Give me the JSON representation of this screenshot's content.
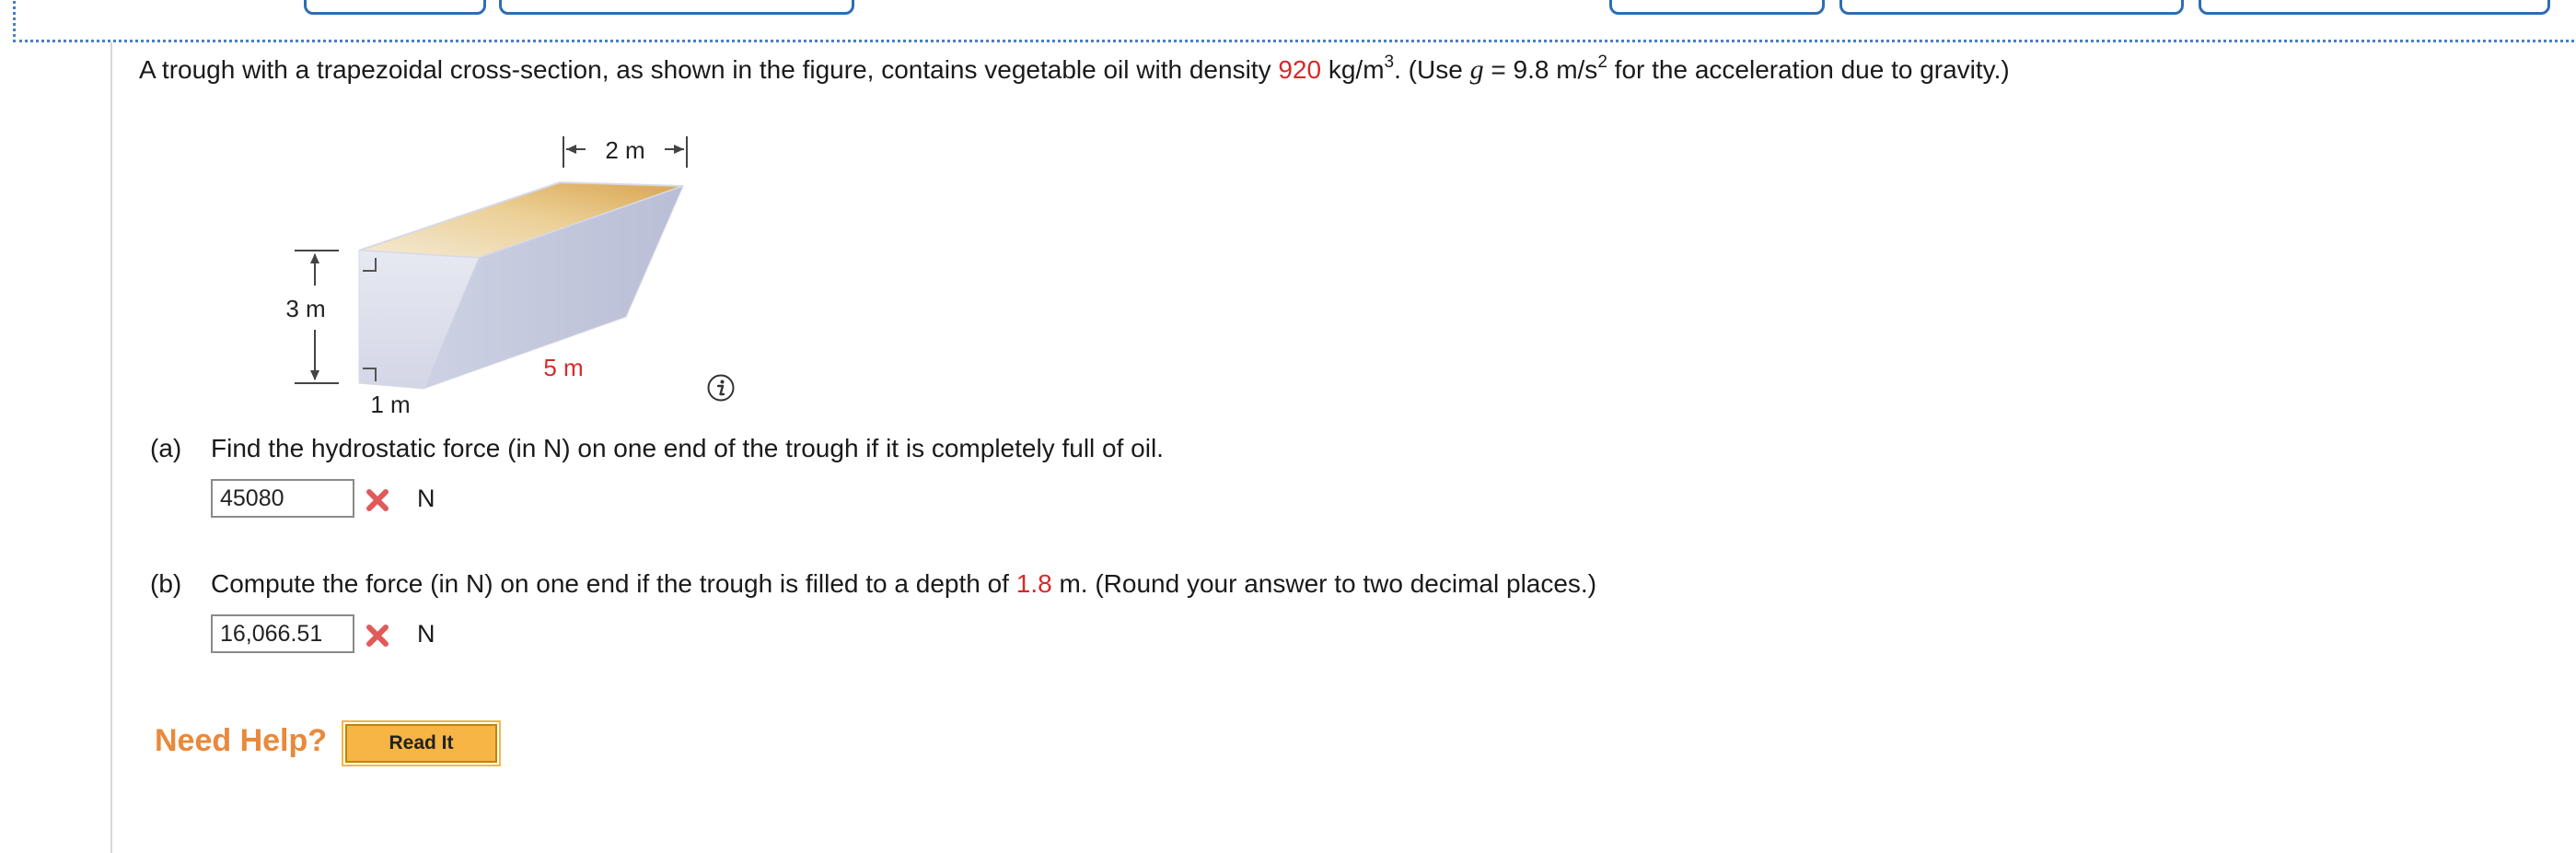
{
  "question": {
    "intro": "A trough with a trapezoidal cross-section, as shown in the figure, contains vegetable oil with density ",
    "density_value": "920",
    "density_unit": " kg/m",
    "density_exp": "3",
    "use_text": ". (Use ",
    "g_symbol": "g",
    "g_equals": " = 9.8 m/s",
    "g_exp": "2",
    "tail": " for the acceleration due to gravity.)"
  },
  "figure": {
    "top_width": "2 m",
    "height": "3 m",
    "length": "5 m",
    "bottom_width": "1 m",
    "colors": {
      "oil_dark": "#d9a85a",
      "oil_light": "#f3e3bf",
      "trough_side": "#c9cde0",
      "trough_end": "#dfe2ee"
    }
  },
  "part_a": {
    "label": "(a)",
    "text": "Find the hydrostatic force (in N) on one end of the trough if it is completely full of oil.",
    "answer": "45080",
    "unit": "N",
    "status": "incorrect"
  },
  "part_b": {
    "label": "(b)",
    "text_before": "Compute the force (in N) on one end if the trough is filled to a depth of ",
    "depth_value": "1.8",
    "text_after": " m. (Round your answer to two decimal places.)",
    "answer": "16,066.51",
    "unit": "N",
    "status": "incorrect"
  },
  "help": {
    "label": "Need Help?",
    "read_it": "Read It"
  },
  "icons": [
    "info-icon",
    "incorrect-x-icon"
  ],
  "colors": {
    "highlight": "#d42b2b",
    "help": "#e8893b",
    "frame": "#2f6db3"
  }
}
